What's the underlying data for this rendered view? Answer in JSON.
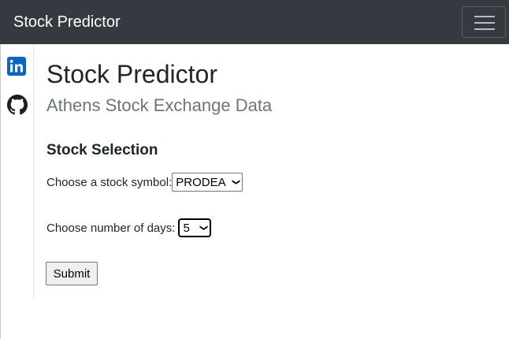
{
  "navbar": {
    "brand": "Stock Predictor",
    "toggler_icon": "hamburger-menu-icon"
  },
  "social": {
    "linkedin_icon": "linkedin-icon",
    "github_icon": "github-icon",
    "linkedin_color": "#0a66c2"
  },
  "main": {
    "title": "Stock Predictor",
    "subtitle": "Athens Stock Exchange Data",
    "section_title": "Stock Selection"
  },
  "form": {
    "symbol_label": "Choose a stock symbol:",
    "symbol_value": "PRODEA",
    "days_label": "Choose number of days:",
    "days_value": "5",
    "submit_label": "Submit"
  },
  "colors": {
    "navbar_bg": "#343a40",
    "subtitle": "#6c757d"
  }
}
